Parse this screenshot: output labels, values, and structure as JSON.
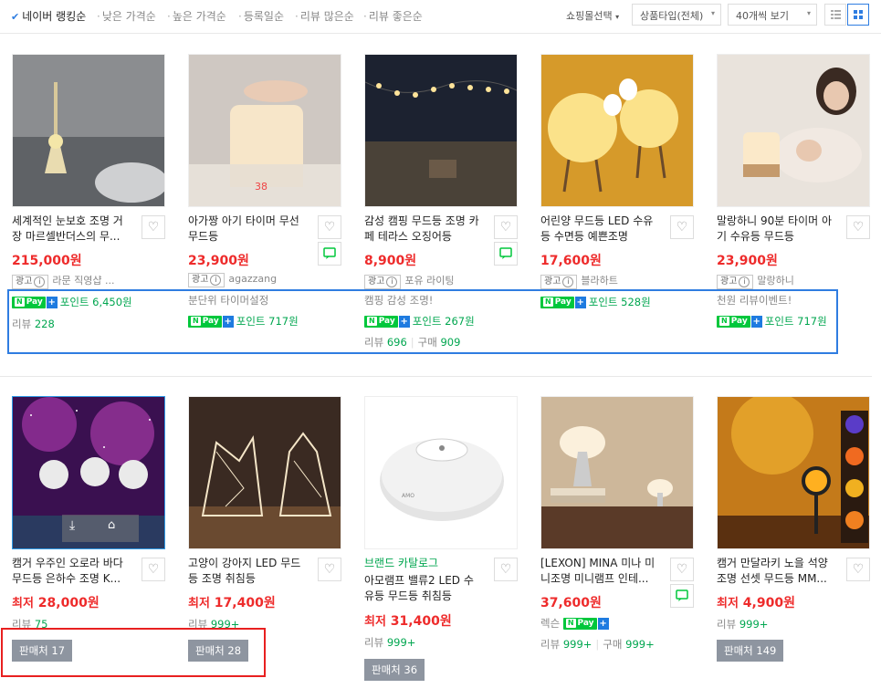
{
  "sort": {
    "items": [
      "네이버 랭킹순",
      "낮은 가격순",
      "높은 가격순",
      "등록일순",
      "리뷰 많은순",
      "리뷰 좋은순"
    ],
    "mall_select": "쇼핑몰선택",
    "product_type": "상품타입(전체)",
    "view_count": "40개씩 보기"
  },
  "row1": [
    {
      "title": "세계적인 눈보호 조명 거장 마르셀반더스의 무...",
      "price": "215,000원",
      "ad_label": "광고",
      "seller": "라문 직영샵 ...",
      "promo": "",
      "point": "포인트 6,450원",
      "review_label": "리뷰",
      "review": "228",
      "buy_label": "",
      "buy": ""
    },
    {
      "title": "아가짱 아기 타이머 무선 무드등",
      "price": "23,900원",
      "ad_label": "광고",
      "seller": "agazzang",
      "promo": "분단위 타이머설정",
      "point": "포인트 717원",
      "review_label": "",
      "review": "",
      "buy_label": "",
      "buy": ""
    },
    {
      "title": "감성 캠핑 무드등 조명 카페 테라스 오징어등",
      "price": "8,900원",
      "ad_label": "광고",
      "seller": "포유 라이팅",
      "promo": "캠핑 감성 조명!",
      "point": "포인트 267원",
      "review_label": "리뷰",
      "review": "696",
      "buy_label": "구매",
      "buy": "909"
    },
    {
      "title": "어린양 무드등 LED 수유등 수면등 예쁜조명",
      "price": "17,600원",
      "ad_label": "광고",
      "seller": "블라하트",
      "promo": "",
      "point": "포인트 528원",
      "review_label": "",
      "review": "",
      "buy_label": "",
      "buy": ""
    },
    {
      "title": "말랑하니 90분 타이머 아기 수유등 무드등",
      "price": "23,900원",
      "ad_label": "광고",
      "seller": "말랑하니",
      "promo": "천원 리뷰이벤트!",
      "point": "포인트 717원",
      "review_label": "",
      "review": "",
      "buy_label": "",
      "buy": ""
    }
  ],
  "row2": [
    {
      "brand": "",
      "title": "캠거 우주인 오로라 바다 무드등 은하수 조명 K...",
      "price_prefix": "최저",
      "price": "28,000원",
      "seller": "",
      "review_label": "리뷰",
      "review": "75",
      "buy_label": "",
      "buy": "",
      "stores": "판매처 17"
    },
    {
      "brand": "",
      "title": "고양이 강아지 LED 무드등 조명 취침등",
      "price_prefix": "최저",
      "price": "17,400원",
      "seller": "",
      "review_label": "리뷰",
      "review": "999+",
      "buy_label": "",
      "buy": "",
      "stores": "판매처 28"
    },
    {
      "brand": "브랜드 카탈로그",
      "title": "아모램프 밸류2 LED 수유등 무드등 취침등",
      "price_prefix": "최저",
      "price": "31,400원",
      "seller": "",
      "review_label": "리뷰",
      "review": "999+",
      "buy_label": "",
      "buy": "",
      "stores": "판매처 36"
    },
    {
      "brand": "",
      "title": "[LEXON] MINA 미나 미니조명 미니램프 인테...",
      "price_prefix": "",
      "price": "37,600원",
      "seller": "렉슨",
      "review_label": "리뷰",
      "review": "999+",
      "buy_label": "구매",
      "buy": "999+",
      "stores": ""
    },
    {
      "brand": "",
      "title": "캠거 만달라키 노을 석양 조명 선셋 무드등 MM...",
      "price_prefix": "최저",
      "price": "4,900원",
      "seller": "",
      "review_label": "리뷰",
      "review": "999+",
      "buy_label": "",
      "buy": "",
      "stores": "판매처 149"
    }
  ],
  "colors": {
    "price": "#ee2b2b",
    "green": "#00a64f",
    "highlight_blue": "#2f7de1",
    "highlight_red": "#e82020"
  }
}
